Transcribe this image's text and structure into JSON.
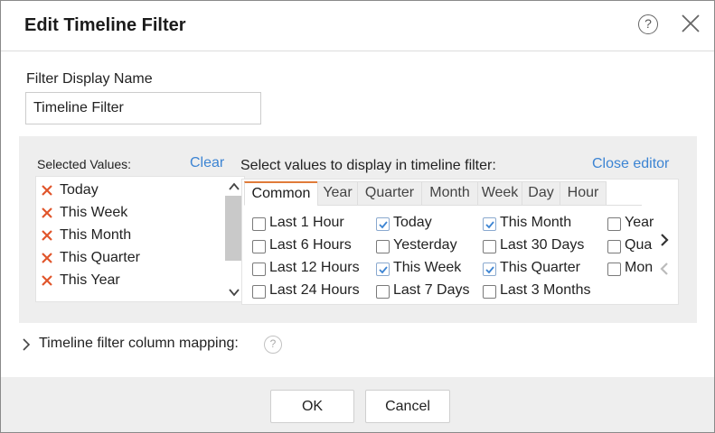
{
  "dialog": {
    "title": "Edit Timeline Filter",
    "help_glyph": "?",
    "icons": {
      "help": "help-circle-icon",
      "close": "close-icon"
    }
  },
  "name_field": {
    "label": "Filter Display Name",
    "value": "Timeline Filter"
  },
  "selected": {
    "label": "Selected Values:",
    "clear_label": "Clear",
    "items": [
      "Today",
      "This Week",
      "This Month",
      "This Quarter",
      "This Year"
    ],
    "remove_icon": "remove-x-icon",
    "remove_color": "#e0552b"
  },
  "values": {
    "label": "Select values to display in timeline filter:",
    "close_editor_label": "Close editor",
    "tabs": [
      {
        "label": "Common",
        "active": true
      },
      {
        "label": "Year",
        "active": false
      },
      {
        "label": "Quarter",
        "active": false
      },
      {
        "label": "Month",
        "active": false
      },
      {
        "label": "Week",
        "active": false
      },
      {
        "label": "Day",
        "active": false
      },
      {
        "label": "Hour",
        "active": false
      }
    ],
    "columns": [
      [
        {
          "label": "Last 1 Hour",
          "checked": false
        },
        {
          "label": "Last 6 Hours",
          "checked": false
        },
        {
          "label": "Last 12 Hours",
          "checked": false
        },
        {
          "label": "Last 24 Hours",
          "checked": false
        }
      ],
      [
        {
          "label": "Today",
          "checked": true
        },
        {
          "label": "Yesterday",
          "checked": false
        },
        {
          "label": "This Week",
          "checked": true
        },
        {
          "label": "Last 7 Days",
          "checked": false
        }
      ],
      [
        {
          "label": "This Month",
          "checked": true
        },
        {
          "label": "Last 30 Days",
          "checked": false
        },
        {
          "label": "This Quarter",
          "checked": true
        },
        {
          "label": "Last 3 Months",
          "checked": false
        }
      ],
      [
        {
          "label": "Year",
          "checked": false
        },
        {
          "label": "Qua",
          "checked": false
        },
        {
          "label": "Mon",
          "checked": false
        }
      ]
    ],
    "icons": {
      "next": "chevron-right-icon",
      "prev": "chevron-left-icon"
    }
  },
  "mapping": {
    "label": "Timeline filter column mapping:",
    "help_glyph": "?",
    "icons": {
      "expand": "chevron-right-icon",
      "help": "help-circle-icon"
    }
  },
  "footer": {
    "ok_label": "OK",
    "cancel_label": "Cancel"
  },
  "colors": {
    "accent_link": "#3c84d3",
    "tab_active_border": "#e07b39",
    "check_color": "#3c84d3",
    "panel_bg": "#eeeeee"
  }
}
